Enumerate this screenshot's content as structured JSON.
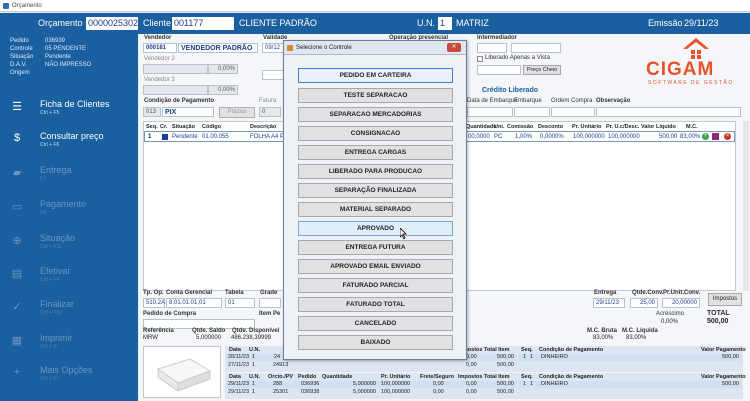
{
  "window": {
    "title": "Orçamento"
  },
  "header": {
    "orcamento_label": "Orçamento",
    "orcamento_value": "0000025302",
    "cliente_label": "Cliente",
    "cliente_code": "001177",
    "cliente_name": "CLIENTE PADRÃO",
    "un_label": "U.N.",
    "un_code": "1",
    "un_name": "MATRIZ",
    "emissao_label": "Emissão",
    "emissao_value": "29/11/23"
  },
  "sidebar": {
    "info": [
      {
        "k": "Pedido",
        "v": "036939"
      },
      {
        "k": "Controle",
        "v": "05  PENDENTE"
      },
      {
        "k": "Situação",
        "v": "Pendente"
      },
      {
        "k": "D.A.V.",
        "v": "NÃO IMPRESSO"
      },
      {
        "k": "Origem",
        "v": ""
      }
    ],
    "items": [
      {
        "label": "Ficha de Clientes",
        "shortcut": "Ctrl + F5",
        "icon": "client-card-icon",
        "enabled": true
      },
      {
        "label": "Consultar preço",
        "shortcut": "Ctrl + F6",
        "icon": "price-icon",
        "enabled": true
      },
      {
        "label": "Entrega",
        "shortcut": "F7",
        "icon": "truck-icon",
        "enabled": false
      },
      {
        "label": "Pagamento",
        "shortcut": "F8",
        "icon": "payment-icon",
        "enabled": false
      },
      {
        "label": "Situação",
        "shortcut": "Ctrl + F11",
        "icon": "status-icon",
        "enabled": false
      },
      {
        "label": "Efetivar",
        "shortcut": "Ctrl + F4",
        "icon": "document-icon",
        "enabled": false
      },
      {
        "label": "Finalizar",
        "shortcut": "Ctrl + F12",
        "icon": "check-icon",
        "enabled": false
      },
      {
        "label": "Imprimir",
        "shortcut": "Ctrl + P",
        "icon": "printer-icon",
        "enabled": false
      },
      {
        "label": "Mais Opções",
        "shortcut": "Ctrl + F7",
        "icon": "plus-icon",
        "enabled": false
      }
    ]
  },
  "form": {
    "vendedor_label": "Vendedor",
    "vendedor_code": "000181",
    "vendedor_name": "VENDEDOR PADRÃO",
    "vendedor2_label": "Vendedor 2",
    "vendedor3_label": "Vendedor 3",
    "pct1": "0,00%",
    "pct2": "0,00%",
    "validade_label": "Validade",
    "validade_value": "09/12",
    "contato_label": "Contato",
    "tipo_nota_label": "Tipo Nota",
    "operacao_label": "Operação presencial",
    "intermediador_label": "Intermediador",
    "liberado_label": "Liberado Apenas a Vista",
    "preco_cheio": "Preço Cheio",
    "cond_pagto_label": "Condição de Pagamento",
    "cond_code": "013",
    "cond_name": "PIX",
    "prazos_btn": "Prazos",
    "fatura_label": "Fatura",
    "fatura_value": "0",
    "credito_label": "Crédito Liberado",
    "data_embarque": "Data de Embarque",
    "embarque": "Embarque",
    "ordem_compra": "Ordem Compra",
    "observacao": "Observação"
  },
  "logo": {
    "brand": "CIGAM",
    "tagline": "SOFTWARE DE GESTÃO"
  },
  "items_table": {
    "headers": [
      "Seq.",
      "Cr.",
      "Situação",
      "Código",
      "Descrição",
      "Quantidade",
      "Uni.",
      "Comissão",
      "Desconto",
      "Pr. Unitário",
      "Pr. U.c/Desc.",
      "Valor Líquido",
      "M.C."
    ],
    "row": {
      "seq": "1",
      "situacao": "Pendente",
      "codigo": "01.00.055",
      "descricao": "FOLHA A4 PA",
      "quantidade": "00,0000",
      "uni": "PC",
      "comissao": "1,00%",
      "desconto": "0,0000%",
      "pr_unit": "100,000000",
      "pr_desc": "100,000000",
      "valor": "500,00",
      "mc": "83,00%"
    }
  },
  "lower": {
    "tp_op_label": "Tp. Op.",
    "tp_op": "510.2A",
    "conta_label": "Conta Gerencial",
    "conta": "8.01.01.01.01",
    "tabela_label": "Tabela",
    "tabela": "01",
    "grade_label": "Grade",
    "pedido_compra_label": "Pedido de Compra",
    "item_pedido_label": "Item Pe",
    "entrega_label": "Entrega",
    "entrega": "29/11/23",
    "qtde_conv_label": "Qtde.Conv.",
    "qtde_conv": "25,00",
    "pr_unit_conv_label": "Pr.Unit.Conv.",
    "pr_unit_conv": "20,00000",
    "impostos_btn": "Impostos",
    "acrescimo_label": "Acréscimo",
    "acrescimo": "0,00%",
    "total_label": "TOTAL",
    "total": "500,00",
    "referencia_label": "Referência",
    "referencia": "MRW",
    "qtde_saldo_label": "Qtde. Saldo",
    "qtde_saldo": "5,000000",
    "qtde_disp_label": "Qtde. Disponível",
    "qtde_disp": "486.238,39999",
    "mc_bruta_label": "M.C. Bruta",
    "mc_bruta": "83,00%",
    "mc_liquida_label": "M.C. Líquida",
    "mc_liquida": "83,00%"
  },
  "history": {
    "h1": [
      "Data",
      "U.N.",
      "Pedido",
      "Impostos",
      "Total Item",
      "Seq.",
      "Condição de Pagamento",
      "Valor Pagamento"
    ],
    "r1": [
      "28/11/23",
      "1",
      "24",
      "0,00",
      "500,00",
      "1",
      "1",
      "DINHEIRO",
      "500,00"
    ],
    "r2": [
      "27/11/23",
      "1",
      "24913",
      "0,00",
      "500,00"
    ],
    "h2": [
      "Data",
      "U.N.",
      "Orcto./PV",
      "Pedido",
      "Quantidade",
      "Pr. Unitário",
      "Frete/Seguro",
      "Impostos",
      "Total Item",
      "Seq.",
      "Condição de Pagamento",
      "Valor Pagamento"
    ],
    "r3": [
      "29/11/23",
      "1",
      "288",
      "036936",
      "5,000000",
      "100,000000",
      "0,00",
      "0,00",
      "500,00",
      "1",
      "1",
      "DINHEIRO",
      "500,00"
    ],
    "r4": [
      "29/11/23",
      "1",
      "25301",
      "036938",
      "5,000000",
      "100,000000",
      "0,00",
      "0,00",
      "500,00"
    ],
    "nfe": "NFE"
  },
  "modal": {
    "title": "Selecione o Controle",
    "options": [
      "PEDIDO EM CARTEIRA",
      "TESTE SEPARACAO",
      "SEPARACAO MERCADORIAS",
      "CONSIGNACAO",
      "ENTREGA CARGAS",
      "LIBERADO PARA PRODUCAO",
      "SEPARAÇÃO FINALIZADA",
      "MATERIAL SEPARADO",
      "APROVADO",
      "ENTREGA FUTURA",
      "APROVADO EMAIL ENVIADO",
      "FATURADO PARCIAL",
      "FATURADO TOTAL",
      "CANCELADO",
      "BAIXADO"
    ]
  }
}
